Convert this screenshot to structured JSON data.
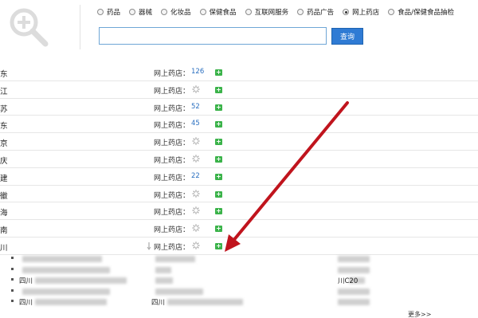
{
  "search": {
    "options": [
      {
        "label": "药品",
        "checked": false
      },
      {
        "label": "器械",
        "checked": false
      },
      {
        "label": "化妆品",
        "checked": false
      },
      {
        "label": "保健食品",
        "checked": false
      },
      {
        "label": "互联网服务",
        "checked": false
      },
      {
        "label": "药品广告",
        "checked": false
      },
      {
        "label": "网上药店",
        "checked": true
      },
      {
        "label": "食品/保健食品抽检",
        "checked": false
      }
    ],
    "query": "",
    "button_label": "查询"
  },
  "list": {
    "rows": [
      {
        "province": "东",
        "label": "网上药店：",
        "count": "126",
        "loading": false,
        "expand": "+"
      },
      {
        "province": "江",
        "label": "网上药店：",
        "count": "",
        "loading": true,
        "expand": "+"
      },
      {
        "province": "苏",
        "label": "网上药店：",
        "count": "52",
        "loading": false,
        "expand": "+"
      },
      {
        "province": "东",
        "label": "网上药店：",
        "count": "45",
        "loading": false,
        "expand": "+"
      },
      {
        "province": "京",
        "label": "网上药店：",
        "count": "",
        "loading": true,
        "expand": "+"
      },
      {
        "province": "庆",
        "label": "网上药店：",
        "count": "",
        "loading": true,
        "expand": "+"
      },
      {
        "province": "建",
        "label": "网上药店：",
        "count": "22",
        "loading": false,
        "expand": "+"
      },
      {
        "province": "徽",
        "label": "网上药店：",
        "count": "",
        "loading": true,
        "expand": "+"
      },
      {
        "province": "海",
        "label": "网上药店：",
        "count": "",
        "loading": true,
        "expand": "+"
      },
      {
        "province": "南",
        "label": "网上药店：",
        "count": "",
        "loading": true,
        "expand": "+"
      },
      {
        "province": "川",
        "label": "网上药店：",
        "count": "",
        "loading": true,
        "expand": "+"
      }
    ]
  },
  "stores": {
    "items": [
      {
        "name": "",
        "name2": "",
        "extra": ""
      },
      {
        "name": "",
        "name2": "",
        "extra": ""
      },
      {
        "name": "四川",
        "name2": "",
        "extra": "川C20"
      },
      {
        "name": "",
        "name2": "",
        "extra": ""
      },
      {
        "name": "四川",
        "name2": "四川",
        "extra": ""
      }
    ],
    "more_label": "更多>>"
  },
  "colors": {
    "accent_blue": "#2f7bd4",
    "expand_green": "#3bb34a",
    "arrow_red": "#c0141d",
    "count_blue": "#2a6fc0"
  }
}
